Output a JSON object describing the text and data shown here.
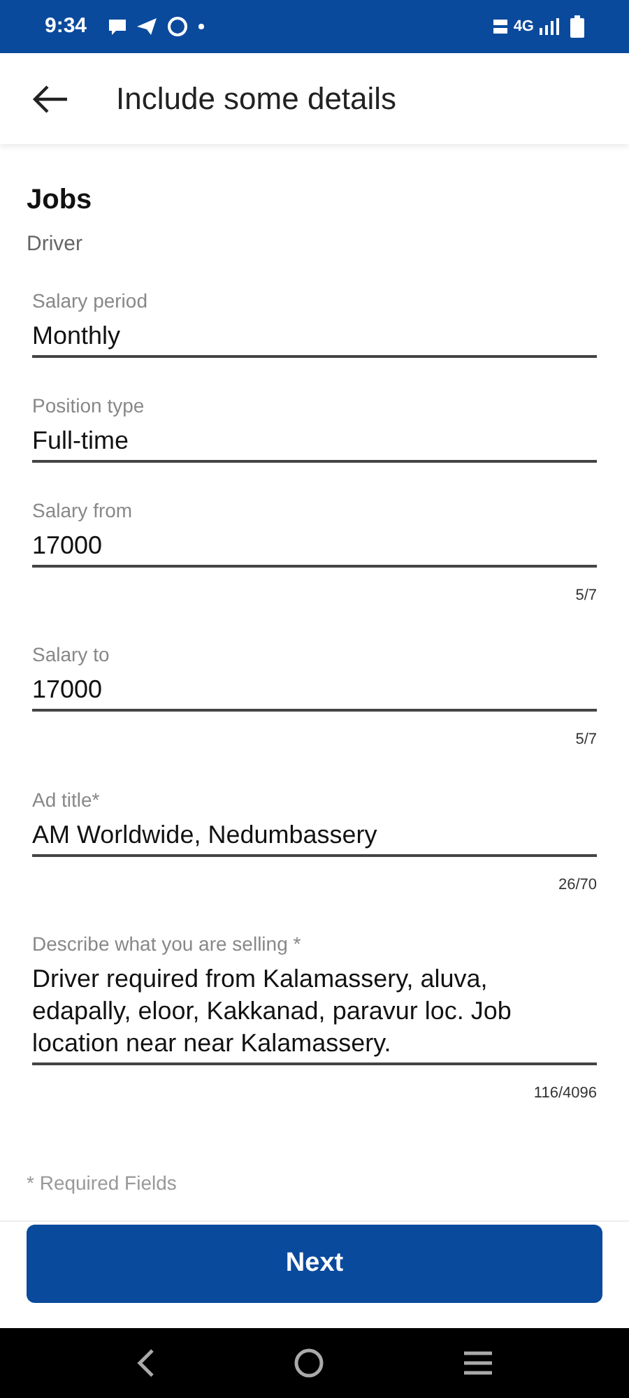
{
  "status_bar": {
    "time": "9:34",
    "network": "4G"
  },
  "header": {
    "title": "Include some details"
  },
  "category": {
    "title": "Jobs",
    "subtitle": "Driver"
  },
  "fields": [
    {
      "label": "Salary period",
      "value": "Monthly"
    },
    {
      "label": "Position type",
      "value": "Full-time"
    },
    {
      "label": "Salary from",
      "value": "17000",
      "counter": "5/7"
    },
    {
      "label": "Salary to",
      "value": "17000",
      "counter": "5/7"
    },
    {
      "label": "Ad title*",
      "value": "AM Worldwide, Nedumbassery",
      "counter": "26/70"
    },
    {
      "label": "Describe what you are selling *",
      "value": "Driver required from Kalamassery, aluva, edapally, eloor, Kakkanad, paravur loc. Job location near near Kalamassery.",
      "counter": "116/4096"
    }
  ],
  "note": "* Required Fields",
  "button": "Next"
}
